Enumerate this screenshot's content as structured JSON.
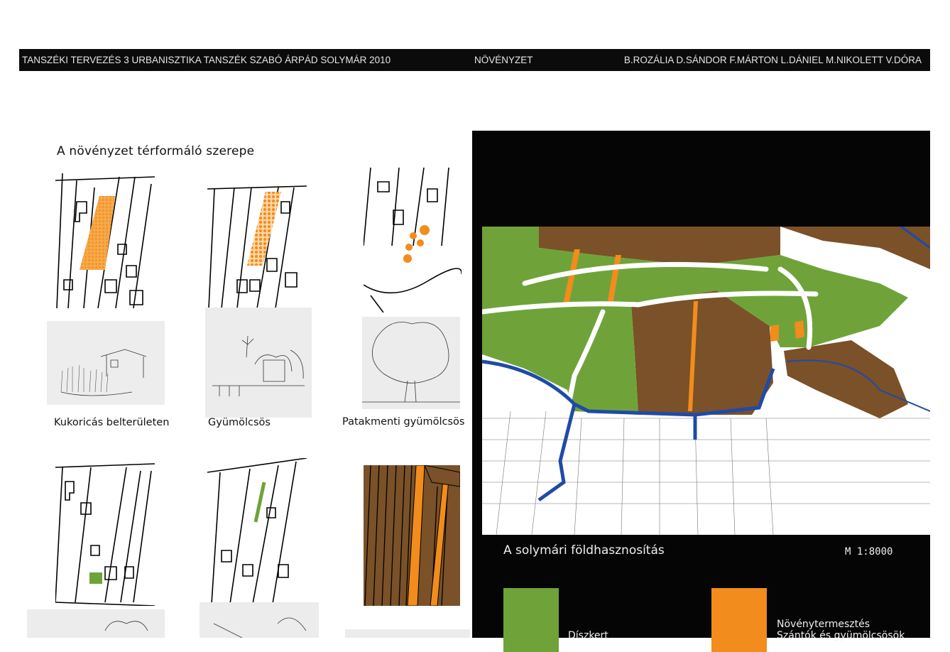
{
  "header": {
    "left": "TANSZÉKI TERVEZÉS 3  URBANISZTIKA TANSZÉK  SZABÓ ÁRPÁD  SOLYMÁR 2010",
    "middle": "NÖVÉNYZET",
    "right": "B.ROZÁLIA   D.SÁNDOR   F.MÁRTON  L.DÁNIEL   M.NIKOLETT   V.DÓRA"
  },
  "section_title": "A növényzet térformáló szerepe",
  "captions": {
    "c1": "Kukoricás belterületen",
    "c2": "Gyümölcsös",
    "c3": "Patakmenti gyümölcsös"
  },
  "map": {
    "title": "A solymári földhasznosítás",
    "scale": "M 1:8000"
  },
  "legend": [
    {
      "label": "Díszkert",
      "color": "#6fa33a"
    },
    {
      "label": "Növénytermesztés\nSzántók és gyümölcsösök",
      "color": "#f28c1c"
    }
  ],
  "colors": {
    "green": "#6fa33a",
    "orange": "#f28c1c",
    "brown": "#7a5128",
    "blue": "#1f4aa8",
    "panel": "#050505"
  }
}
